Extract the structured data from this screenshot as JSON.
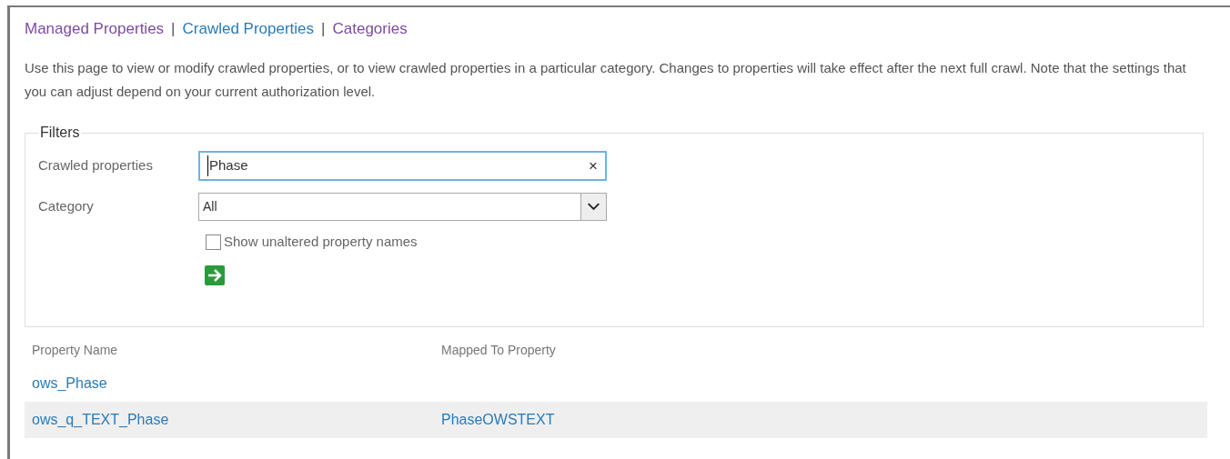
{
  "nav_links": [
    {
      "label": "Managed Properties",
      "visited": true
    },
    {
      "label": "Crawled Properties",
      "visited": false
    },
    {
      "label": "Categories",
      "visited": true
    }
  ],
  "separator": "|",
  "description": "Use this page to view or modify crawled properties, or to view crawled properties in a particular category. Changes to properties will take effect after the next full crawl. Note that the settings that you can adjust depend on your current authorization level.",
  "filters": {
    "legend": "Filters",
    "crawled_properties": {
      "label": "Crawled properties",
      "value": "Phase",
      "clear": "×"
    },
    "category": {
      "label": "Category",
      "value": "All"
    },
    "show_unaltered": {
      "label": "Show unaltered property names",
      "checked": false
    }
  },
  "table": {
    "columns": [
      "Property Name",
      "Mapped To Property"
    ],
    "rows": [
      {
        "name": "ows_Phase",
        "highlighted": false
      },
      {
        "name": "ows_q_TEXT_Phase",
        "mapped_to": "PhaseOWSTEXT",
        "highlighted": true
      }
    ]
  }
}
